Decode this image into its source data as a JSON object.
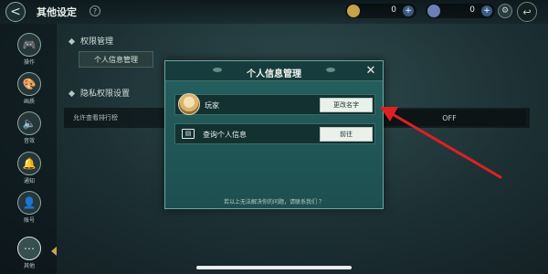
{
  "header": {
    "back_icon": "chevron-left-icon",
    "title": "其他设定",
    "help_glyph": "?",
    "currencies": [
      {
        "icon": "gold-coin-icon",
        "value": "0",
        "add": "+"
      },
      {
        "icon": "gem-icon",
        "value": "0",
        "add": "+"
      }
    ],
    "settings_glyph": "⚙",
    "exit_glyph": "↩"
  },
  "sidebar": {
    "items": [
      {
        "label": "操作",
        "icon": "gamepad-icon",
        "glyph": "🎮"
      },
      {
        "label": "画质",
        "icon": "palette-icon",
        "glyph": "🎨"
      },
      {
        "label": "音效",
        "icon": "speaker-icon",
        "glyph": "🔈"
      },
      {
        "label": "通知",
        "icon": "bell-icon",
        "glyph": "🔔"
      },
      {
        "label": "账号",
        "icon": "account-icon",
        "glyph": "👤"
      },
      {
        "label": "其他",
        "icon": "more-icon",
        "glyph": "⋯"
      }
    ],
    "active_index": 5
  },
  "content": {
    "section_permissions": "权限管理",
    "personal_info_button": "个人信息管理",
    "section_privacy": "隐私权限设置",
    "leaderboard_label": "允许查看排行榜",
    "leaderboard_toggle": "OFF"
  },
  "modal": {
    "title": "个人信息管理",
    "close_glyph": "✕",
    "rows": [
      {
        "icon": "avatar",
        "label": "玩家",
        "button": "更改名字"
      },
      {
        "icon": "id-card-icon",
        "label": "查询个人信息",
        "button": "前往"
      }
    ],
    "footer": "若以上无法解决你的问题，请联系我们 ？"
  },
  "colors": {
    "annotation_arrow": "#e02020",
    "modal_bg": "#1d4f50",
    "button_bg": "#eaf0ea"
  }
}
